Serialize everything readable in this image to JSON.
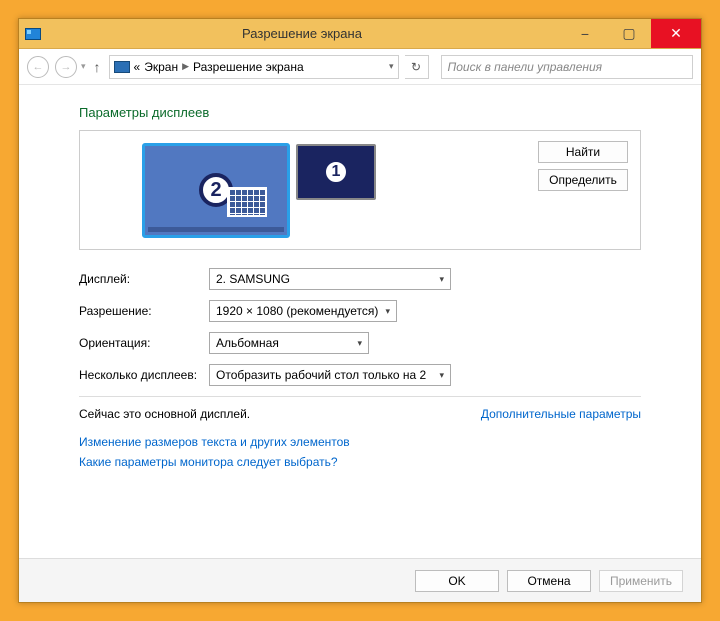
{
  "window": {
    "title": "Разрешение экрана"
  },
  "breadcrumb": {
    "prefix": "«",
    "item1": "Экран",
    "item2": "Разрешение экрана"
  },
  "search": {
    "placeholder": "Поиск в панели управления"
  },
  "heading": "Параметры дисплеев",
  "monitors": {
    "primary_num": "2",
    "secondary_num": "1"
  },
  "arrangement_buttons": {
    "find": "Найти",
    "identify": "Определить"
  },
  "fields": {
    "display_label": "Дисплей:",
    "display_value": "2. SAMSUNG",
    "resolution_label": "Разрешение:",
    "resolution_value": "1920 × 1080 (рекомендуется)",
    "orientation_label": "Ориентация:",
    "orientation_value": "Альбомная",
    "multi_label": "Несколько дисплеев:",
    "multi_value": "Отобразить рабочий стол только на 2"
  },
  "status": "Сейчас это основной дисплей.",
  "advanced_link": "Дополнительные параметры",
  "link_textsize": "Изменение размеров текста и других элементов",
  "link_help": "Какие параметры монитора следует выбрать?",
  "buttons": {
    "ok": "OK",
    "cancel": "Отмена",
    "apply": "Применить"
  }
}
